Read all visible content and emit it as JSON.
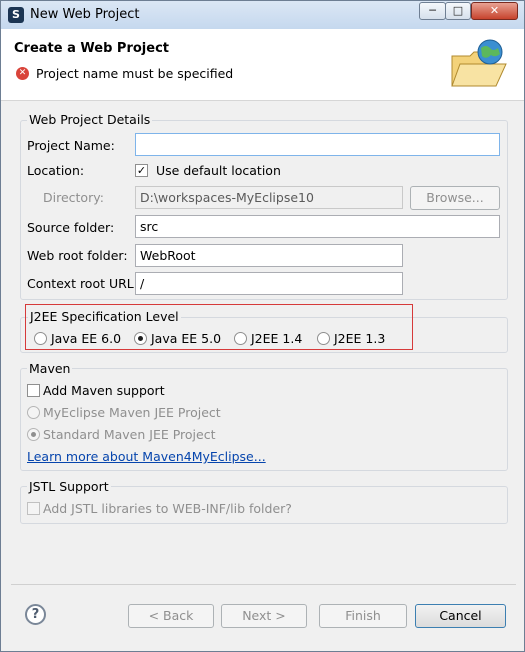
{
  "window": {
    "title": "New Web Project",
    "minimize": "─",
    "maximize": "□",
    "close": "✕"
  },
  "banner": {
    "heading": "Create a Web Project",
    "error_message": "Project name must be specified"
  },
  "details": {
    "title": "Web Project Details",
    "project_name_label": "Project Name:",
    "project_name_value": "",
    "location_label": "Location:",
    "use_default_location_label": "Use default location",
    "use_default_checked": "✓",
    "directory_label": "Directory:",
    "directory_value": "D:\\workspaces-MyEclipse10",
    "browse_label": "Browse...",
    "source_folder_label": "Source folder:",
    "source_folder_value": "src",
    "web_root_label": "Web root folder:",
    "web_root_value": "WebRoot",
    "context_root_label": "Context root URL:",
    "context_root_value": "/"
  },
  "j2ee": {
    "title": "J2EE Specification Level",
    "options": [
      "Java EE 6.0",
      "Java EE 5.0",
      "J2EE 1.4",
      "J2EE 1.3"
    ],
    "selected": "Java EE 5.0"
  },
  "maven": {
    "title": "Maven",
    "add_support_label": "Add Maven support",
    "options": [
      "MyEclipse Maven JEE Project",
      "Standard Maven JEE Project"
    ],
    "selected": "Standard Maven JEE Project",
    "learn_more": "Learn more about Maven4MyEclipse..."
  },
  "jstl": {
    "title": "JSTL Support",
    "add_libraries_label": "Add JSTL libraries to WEB-INF/lib folder?"
  },
  "footer": {
    "help": "?",
    "back": "< Back",
    "next": "Next >",
    "finish": "Finish",
    "cancel": "Cancel"
  }
}
